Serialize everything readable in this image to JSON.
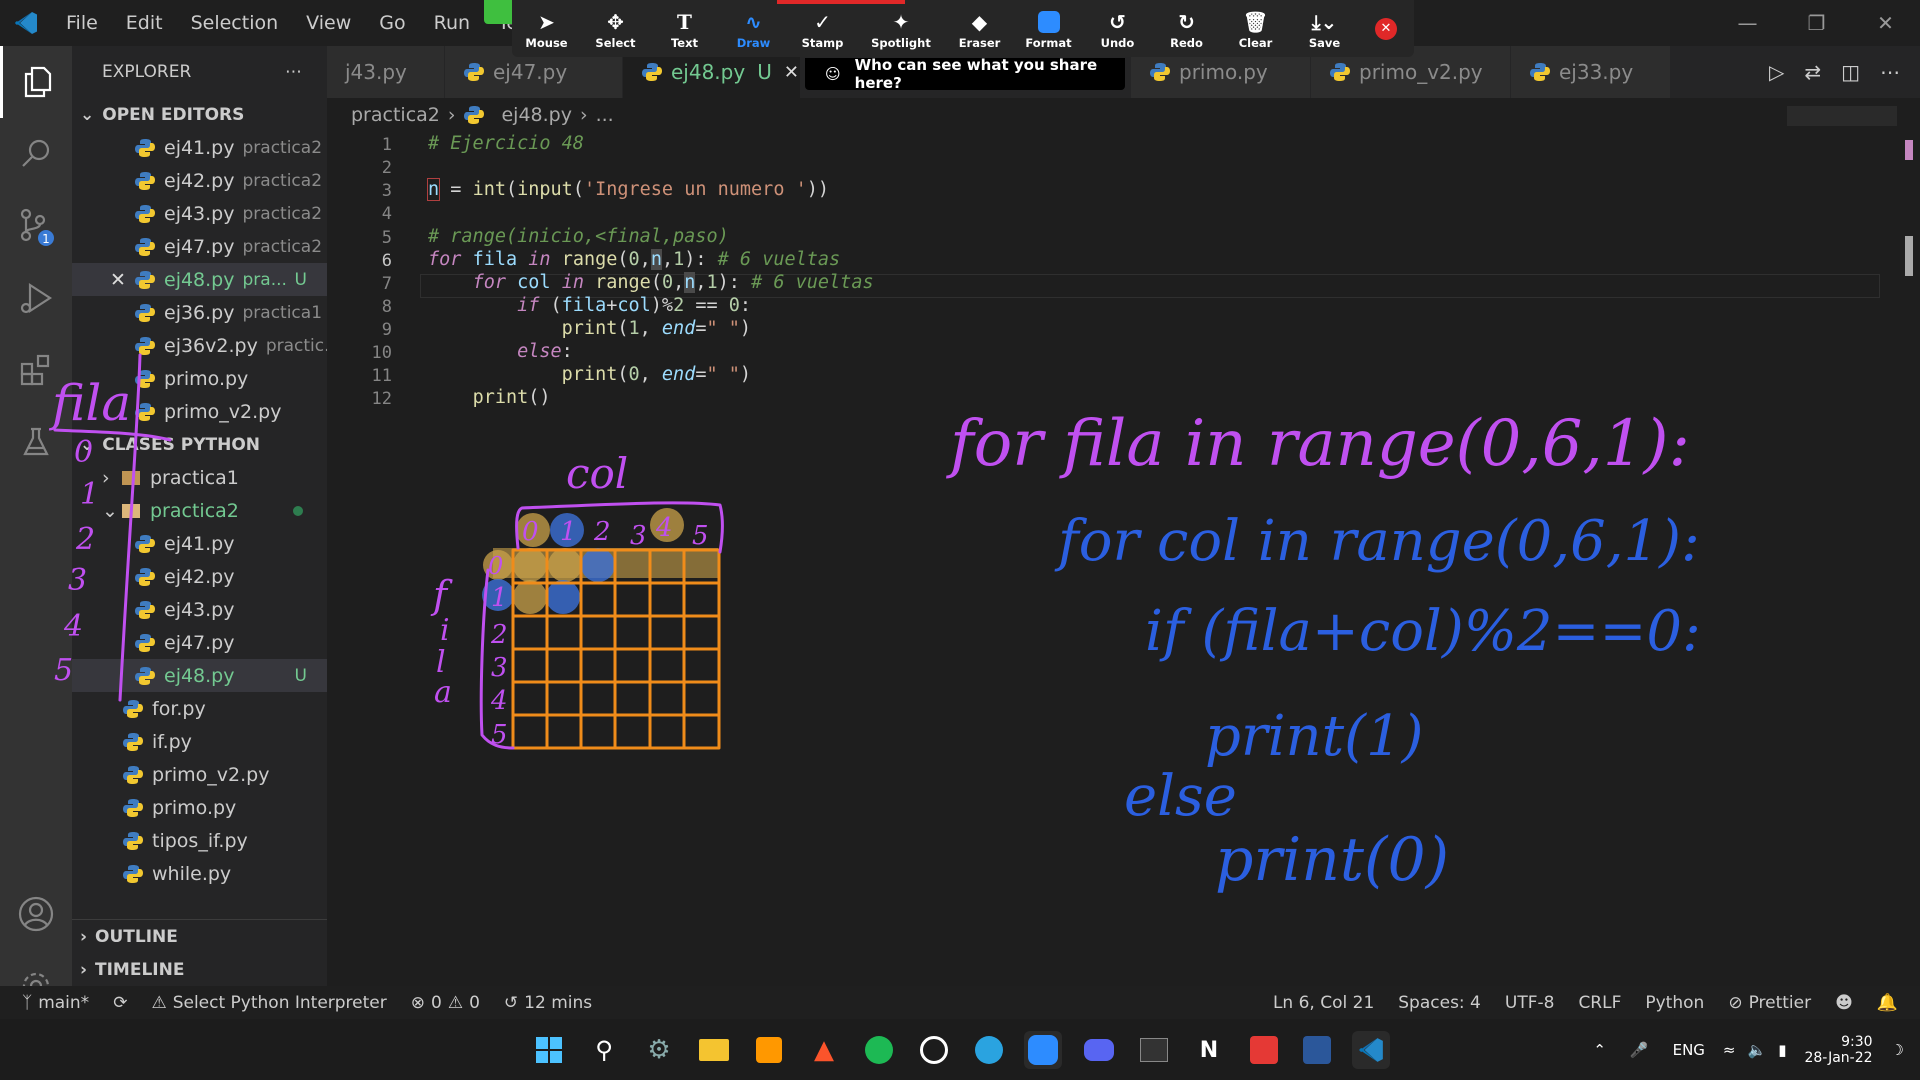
{
  "titlebar": {
    "menu": [
      "File",
      "Edit",
      "Selection",
      "View",
      "Go",
      "Run",
      "Term"
    ]
  },
  "zoom_toolbar": {
    "tools": [
      {
        "label": "Mouse",
        "icon": "mouse-pointer-icon"
      },
      {
        "label": "Select",
        "icon": "move-arrows-icon"
      },
      {
        "label": "Text",
        "icon": "text-T-icon"
      },
      {
        "label": "Draw",
        "icon": "draw-squiggle-icon"
      },
      {
        "label": "Stamp",
        "icon": "checkmark-stamp-icon"
      },
      {
        "label": "Spotlight",
        "icon": "spotlight-wand-icon"
      },
      {
        "label": "Eraser",
        "icon": "eraser-icon"
      },
      {
        "label": "Format",
        "icon": "format-square-icon"
      },
      {
        "label": "Undo",
        "icon": "undo-icon"
      },
      {
        "label": "Redo",
        "icon": "redo-icon"
      },
      {
        "label": "Clear",
        "icon": "trash-icon"
      },
      {
        "label": "Save",
        "icon": "save-download-icon"
      }
    ],
    "share_notice": "Who can see what you share here?",
    "active_tool": "Draw",
    "accent": "#2d8cff"
  },
  "sidebar": {
    "title": "EXPLORER",
    "open_editors_header": "OPEN EDITORS",
    "open_editors": [
      {
        "name": "ej41.py",
        "folder": "practica2"
      },
      {
        "name": "ej42.py",
        "folder": "practica2"
      },
      {
        "name": "ej43.py",
        "folder": "practica2"
      },
      {
        "name": "ej47.py",
        "folder": "practica2"
      },
      {
        "name": "ej48.py",
        "folder": "pra...",
        "badge": "U"
      },
      {
        "name": "ej36.py",
        "folder": "practica1"
      },
      {
        "name": "ej36v2.py",
        "folder": "practic..."
      },
      {
        "name": "primo.py",
        "folder": ""
      },
      {
        "name": "primo_v2.py",
        "folder": ""
      }
    ],
    "workspace_header": "CLASES PYTHON",
    "folders": [
      {
        "name": "practica1"
      },
      {
        "name": "practica2"
      }
    ],
    "practica2_files": [
      {
        "name": "ej41.py"
      },
      {
        "name": "ej42.py"
      },
      {
        "name": "ej43.py"
      },
      {
        "name": "ej47.py"
      },
      {
        "name": "ej48.py",
        "badge": "U"
      }
    ],
    "root_files": [
      "for.py",
      "if.py",
      "primo_v2.py",
      "primo.py",
      "tipos_if.py",
      "while.py"
    ],
    "outline": "OUTLINE",
    "timeline": "TIMELINE"
  },
  "tabs": [
    {
      "label": "j43.py"
    },
    {
      "label": "ej47.py"
    },
    {
      "label": "ej48.py",
      "badge": "U"
    },
    {
      "label": "primo.py"
    },
    {
      "label": "primo_v2.py"
    },
    {
      "label": "ej33.py"
    }
  ],
  "breadcrumb": {
    "folder": "practica2",
    "file": "ej48.py",
    "tail": "..."
  },
  "code": {
    "line_numbers": [
      "1",
      "2",
      "3",
      "4",
      "5",
      "6",
      "7",
      "8",
      "9",
      "10",
      "11",
      "12"
    ],
    "active_line": "6"
  },
  "annotations": {
    "sidebar_word": "fila",
    "sidebar_digits": [
      "0",
      "1",
      "2",
      "3",
      "4",
      "5"
    ],
    "grid_col_label": "col",
    "grid_row_letters": [
      "f",
      "i",
      "l",
      "a"
    ],
    "grid_col_digits": [
      "0",
      "1",
      "2",
      "3",
      "4",
      "5"
    ],
    "grid_row_digits": [
      "0",
      "1",
      "2",
      "3",
      "4",
      "5"
    ],
    "hand_lines": [
      "for fila in range(0,6,1):",
      "for col in range(0,6,1):",
      "if (fila+col)%2==0:",
      "print(1)",
      "else",
      "print(0)"
    ],
    "ink_color": "#c050f0",
    "blue_ink": "#2b5fe0",
    "grid_color": "#f08c1a"
  },
  "statusbar": {
    "branch": "main*",
    "interpreter": "Select Python Interpreter",
    "errors": "0",
    "warnings": "0",
    "time": "12 mins",
    "position": "Ln 6, Col 21",
    "spaces": "Spaces: 4",
    "encoding": "UTF-8",
    "eol": "CRLF",
    "language": "Python",
    "formatter": "Prettier"
  },
  "taskbar": {
    "lang": "ENG",
    "time": "9:30",
    "date": "28-Jan-22"
  }
}
